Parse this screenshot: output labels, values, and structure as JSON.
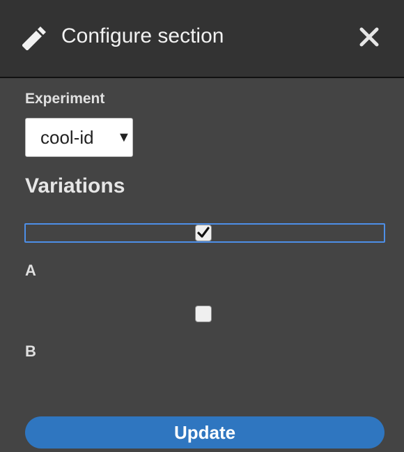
{
  "header": {
    "title": "Configure section",
    "edit_icon": "pencil-icon",
    "close_icon": "close-icon"
  },
  "experiment": {
    "label": "Experiment",
    "selected": "cool-id",
    "arrow": "▼"
  },
  "variations": {
    "title": "Variations",
    "items": [
      {
        "label": "A",
        "checked": true
      },
      {
        "label": "B",
        "checked": false
      }
    ]
  },
  "actions": {
    "update_label": "Update"
  },
  "colors": {
    "background": "#444444",
    "header": "#333333",
    "accent": "#2f76c0",
    "focus": "#4d8fe8"
  }
}
